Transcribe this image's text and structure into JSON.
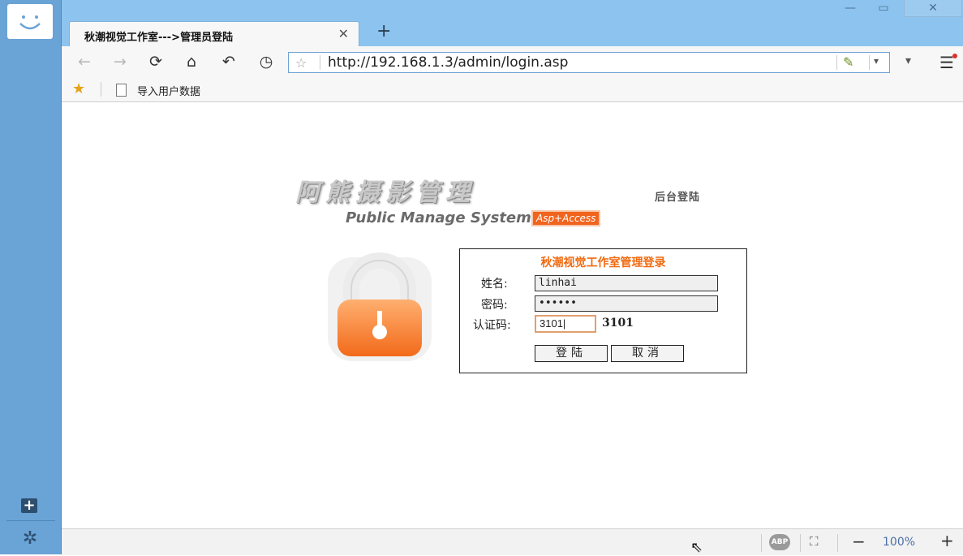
{
  "browser": {
    "tab_title": "秋潮视觉工作室--->管理员登陆",
    "tab_close": "✕",
    "new_tab": "+",
    "window": {
      "minimize": "—",
      "maximize": "▭",
      "close": "✕"
    },
    "url": "http://192.168.1.3/admin/login.asp",
    "bookmark_label": "导入用户数据",
    "zoom": "100%",
    "abp": "ABP"
  },
  "icons": {
    "back": "←",
    "forward": "→",
    "reload": "⟳",
    "home": "⌂",
    "undo": "↶",
    "history": "◷",
    "star": "☆",
    "bookmark_star": "★",
    "leaf": "✎",
    "dropdown": "▾",
    "more": "▾",
    "menu": "☰",
    "sidebar_add": "+",
    "settings": "✲",
    "fullscreen": "⛶",
    "zoom_out": "−",
    "zoom_in": "+"
  },
  "page": {
    "logo_cn": "阿熊摄影管理",
    "logo_en": "Public Manage System",
    "logo_badge": "Asp+Access",
    "logo_side": "后台登陆",
    "login": {
      "title": "秋潮视觉工作室管理登录",
      "username_label": "姓名:",
      "username_value": "linhai",
      "password_label": "密码:",
      "password_value": "••••••",
      "code_label": "认证码:",
      "code_value": "3101|",
      "code_display": "3101",
      "submit_label": "登陆",
      "cancel_label": "取消"
    }
  }
}
